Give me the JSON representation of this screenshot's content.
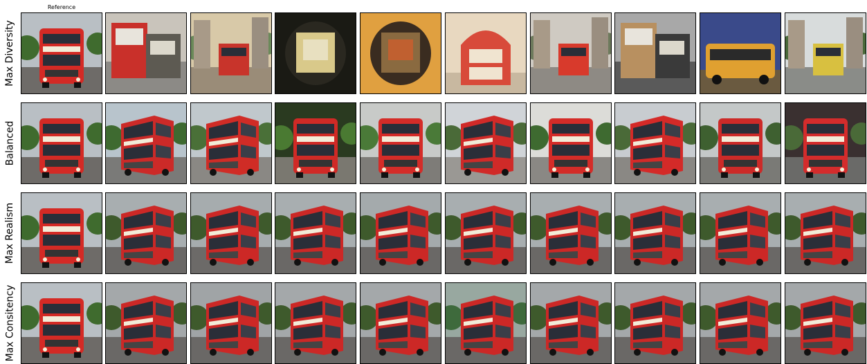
{
  "reference_label": "Reference",
  "rows": [
    {
      "label": "Max Diversity",
      "tiles": [
        {
          "sky": "#b9bfc4",
          "ground": "#6e6b68",
          "tree": "#3f6b2e",
          "bus": "#d42a25",
          "style": "bus-front"
        },
        {
          "sky": "#c9c4bb",
          "ground": "#8c8a86",
          "tree": "#5d5a52",
          "bus": "#c9302a",
          "style": "clutter"
        },
        {
          "sky": "#d8c9a8",
          "ground": "#9a8c78",
          "tree": "#6b8a5a",
          "bus": "#c8342b",
          "style": "street"
        },
        {
          "sky": "#1a1a14",
          "ground": "#2a2820",
          "tree": "#d9c98a",
          "bus": "#e8e0c0",
          "style": "dark"
        },
        {
          "sky": "#e0a040",
          "ground": "#3a2c20",
          "tree": "#8a6a40",
          "bus": "#c06030",
          "style": "dark"
        },
        {
          "sky": "#e8d8c0",
          "ground": "#c8b8a0",
          "tree": "#a89078",
          "bus": "#d84a3a",
          "style": "arch"
        },
        {
          "sky": "#cfcac2",
          "ground": "#8e8a84",
          "tree": "#6d7a5c",
          "bus": "#d83a2c",
          "style": "street"
        },
        {
          "sky": "#a8a8a8",
          "ground": "#5a5a5a",
          "tree": "#3a3a3a",
          "bus": "#b89060",
          "style": "clutter"
        },
        {
          "sky": "#3a4a8a",
          "ground": "#6a5a40",
          "tree": "#d8a040",
          "bus": "#e0a030",
          "style": "side"
        },
        {
          "sky": "#d8dcdc",
          "ground": "#8a8c88",
          "tree": "#4a6a3a",
          "bus": "#d8c040",
          "style": "street"
        }
      ]
    },
    {
      "label": "Balanced",
      "tiles": [
        {
          "sky": "#b9bfc4",
          "ground": "#6e6b68",
          "tree": "#3f6b2e",
          "bus": "#d42a25",
          "style": "bus-front"
        },
        {
          "sky": "#b8c4cc",
          "ground": "#7a7a78",
          "tree": "#3e6a30",
          "bus": "#cc2a28",
          "style": "bus-angle"
        },
        {
          "sky": "#c0c8cc",
          "ground": "#8a8884",
          "tree": "#4a7038",
          "bus": "#d02c26",
          "style": "bus-angle"
        },
        {
          "sky": "#2a3a20",
          "ground": "#7a7870",
          "tree": "#4a7a32",
          "bus": "#d02a26",
          "style": "bus-front"
        },
        {
          "sky": "#c8cac8",
          "ground": "#7e7c78",
          "tree": "#4a7a38",
          "bus": "#d42c28",
          "style": "bus-front"
        },
        {
          "sky": "#d0d4d8",
          "ground": "#9a9894",
          "tree": "#4a6a38",
          "bus": "#d02a28",
          "style": "bus-angle"
        },
        {
          "sky": "#dcdcd8",
          "ground": "#8a8884",
          "tree": "#3e6a30",
          "bus": "#d42c28",
          "style": "bus-front"
        },
        {
          "sky": "#c8ccd0",
          "ground": "#8a8884",
          "tree": "#4a6a38",
          "bus": "#d42a28",
          "style": "bus-angle"
        },
        {
          "sky": "#c4c8c8",
          "ground": "#7a7a76",
          "tree": "#3e6030",
          "bus": "#cc2a28",
          "style": "bus-front"
        },
        {
          "sky": "#3a3030",
          "ground": "#6a6a68",
          "tree": "#4a6a38",
          "bus": "#d42c2c",
          "style": "bus-front"
        }
      ]
    },
    {
      "label": "Max Realism",
      "tiles": [
        {
          "sky": "#b9bfc4",
          "ground": "#6e6b68",
          "tree": "#3f6b2e",
          "bus": "#d42a25",
          "style": "bus-front"
        },
        {
          "sky": "#a8aeb0",
          "ground": "#6a6866",
          "tree": "#3e5a2c",
          "bus": "#cc2826",
          "style": "bus-angle"
        },
        {
          "sky": "#a6acae",
          "ground": "#6c6a68",
          "tree": "#3e5a2c",
          "bus": "#cc2826",
          "style": "bus-angle"
        },
        {
          "sky": "#a8aeb0",
          "ground": "#6a6866",
          "tree": "#3e5a2c",
          "bus": "#cc2826",
          "style": "bus-angle"
        },
        {
          "sky": "#a4aaac",
          "ground": "#6a6866",
          "tree": "#3e5a2c",
          "bus": "#cc2826",
          "style": "bus-angle"
        },
        {
          "sky": "#a8aeb0",
          "ground": "#6a6866",
          "tree": "#3e5a2c",
          "bus": "#cc2826",
          "style": "bus-angle"
        },
        {
          "sky": "#a8aeb0",
          "ground": "#6a6866",
          "tree": "#3e5a2c",
          "bus": "#cc2826",
          "style": "bus-angle"
        },
        {
          "sky": "#a8aeb0",
          "ground": "#6a6866",
          "tree": "#3e5a2c",
          "bus": "#cc2826",
          "style": "bus-angle"
        },
        {
          "sky": "#a8aeb0",
          "ground": "#6a6866",
          "tree": "#3e5a2c",
          "bus": "#cc2826",
          "style": "bus-angle"
        },
        {
          "sky": "#a8aeb0",
          "ground": "#6a6866",
          "tree": "#3e5a2c",
          "bus": "#cc2826",
          "style": "bus-angle"
        }
      ]
    },
    {
      "label": "Max Consitency",
      "tiles": [
        {
          "sky": "#b9bfc4",
          "ground": "#6e6b68",
          "tree": "#3f6b2e",
          "bus": "#d42a25",
          "style": "bus-front"
        },
        {
          "sky": "#a4a8aa",
          "ground": "#6a6866",
          "tree": "#3e5a2c",
          "bus": "#cc2826",
          "style": "bus-angle"
        },
        {
          "sky": "#a0a4a6",
          "ground": "#6a6866",
          "tree": "#3e5a2c",
          "bus": "#cc2826",
          "style": "bus-angle"
        },
        {
          "sky": "#a4a8aa",
          "ground": "#6a6866",
          "tree": "#3e5a2c",
          "bus": "#cc2826",
          "style": "bus-angle"
        },
        {
          "sky": "#a4a8aa",
          "ground": "#6a6866",
          "tree": "#3e5a2c",
          "bus": "#cc2826",
          "style": "bus-angle"
        },
        {
          "sky": "#98a8a0",
          "ground": "#6a6866",
          "tree": "#3e6a3c",
          "bus": "#cc2826",
          "style": "bus-angle"
        },
        {
          "sky": "#a4a8aa",
          "ground": "#6a6866",
          "tree": "#3e5a2c",
          "bus": "#cc2826",
          "style": "bus-angle"
        },
        {
          "sky": "#a4a8aa",
          "ground": "#6a6866",
          "tree": "#3e5a2c",
          "bus": "#cc2826",
          "style": "bus-angle"
        },
        {
          "sky": "#a4a8aa",
          "ground": "#6a6866",
          "tree": "#3e5a2c",
          "bus": "#cc2826",
          "style": "bus-angle"
        },
        {
          "sky": "#a4a8aa",
          "ground": "#6a6866",
          "tree": "#3e5a2c",
          "bus": "#cc2826",
          "style": "bus-angle"
        }
      ]
    }
  ]
}
